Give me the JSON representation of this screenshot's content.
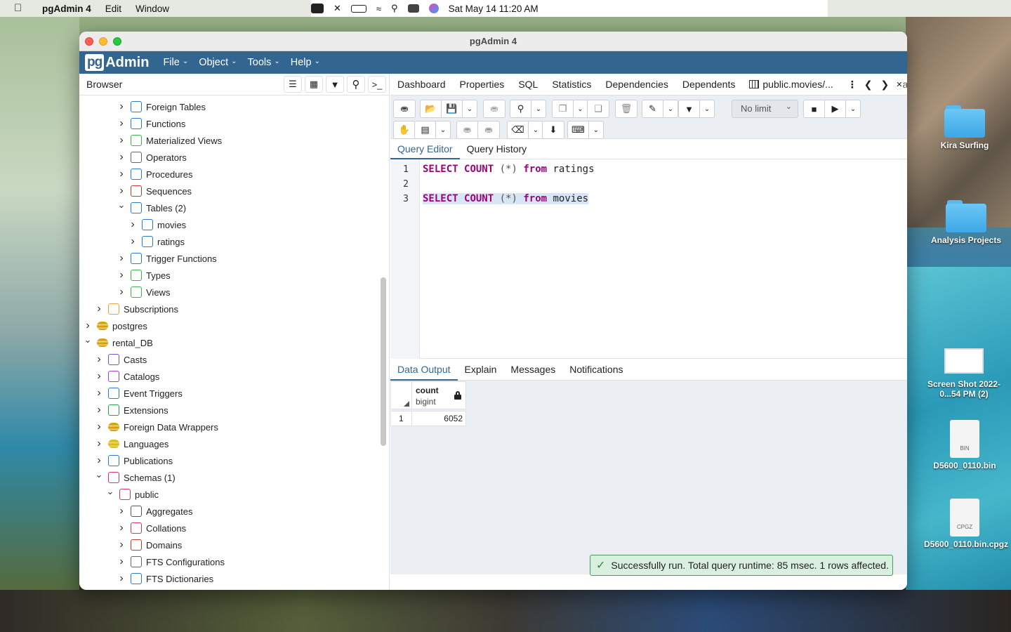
{
  "menubar": {
    "app": "pgAdmin 4",
    "items": [
      "Edit",
      "Window"
    ],
    "clock": "Sat May 14  11:20 AM"
  },
  "window": {
    "title": "pgAdmin 4"
  },
  "appnav": {
    "logo_pg": "pg",
    "logo_admin": "Admin",
    "menus": [
      "File",
      "Object",
      "Tools",
      "Help"
    ]
  },
  "browser": {
    "title": "Browser",
    "tree": [
      {
        "label": "Foreign Tables",
        "icon": "foreign-table-icon",
        "expanded": false
      },
      {
        "label": "Functions",
        "icon": "function-icon",
        "expanded": false
      },
      {
        "label": "Materialized Views",
        "icon": "materialized-view-icon",
        "expanded": false
      },
      {
        "label": "Operators",
        "icon": "operator-icon",
        "expanded": false
      },
      {
        "label": "Procedures",
        "icon": "procedure-icon",
        "expanded": false
      },
      {
        "label": "Sequences",
        "icon": "sequence-icon",
        "expanded": false
      },
      {
        "label": "Tables (2)",
        "icon": "tables-icon",
        "expanded": true
      },
      {
        "label": "movies",
        "icon": "table-icon",
        "expanded": false
      },
      {
        "label": "ratings",
        "icon": "table-icon",
        "expanded": false
      },
      {
        "label": "Trigger Functions",
        "icon": "trigger-function-icon",
        "expanded": false
      },
      {
        "label": "Types",
        "icon": "type-icon",
        "expanded": false
      },
      {
        "label": "Views",
        "icon": "view-icon",
        "expanded": false
      },
      {
        "label": "Subscriptions",
        "icon": "subscription-icon",
        "expanded": false
      },
      {
        "label": "postgres",
        "icon": "database-icon",
        "expanded": false
      },
      {
        "label": "rental_DB",
        "icon": "database-icon",
        "expanded": true
      },
      {
        "label": "Casts",
        "icon": "cast-icon",
        "expanded": false
      },
      {
        "label": "Catalogs",
        "icon": "catalog-icon",
        "expanded": false
      },
      {
        "label": "Event Triggers",
        "icon": "event-trigger-icon",
        "expanded": false
      },
      {
        "label": "Extensions",
        "icon": "extension-icon",
        "expanded": false
      },
      {
        "label": "Foreign Data Wrappers",
        "icon": "fdw-icon",
        "expanded": false
      },
      {
        "label": "Languages",
        "icon": "language-icon",
        "expanded": false
      },
      {
        "label": "Publications",
        "icon": "publication-icon",
        "expanded": false
      },
      {
        "label": "Schemas (1)",
        "icon": "schema-icon",
        "expanded": true
      },
      {
        "label": "public",
        "icon": "schema-public-icon",
        "expanded": true
      },
      {
        "label": "Aggregates",
        "icon": "aggregate-icon",
        "expanded": false
      },
      {
        "label": "Collations",
        "icon": "collation-icon",
        "expanded": false
      },
      {
        "label": "Domains",
        "icon": "domain-icon",
        "expanded": false
      },
      {
        "label": "FTS Configurations",
        "icon": "fts-config-icon",
        "expanded": false
      },
      {
        "label": "FTS Dictionaries",
        "icon": "fts-dictionary-icon",
        "expanded": false
      }
    ]
  },
  "tabs": [
    "Dashboard",
    "Properties",
    "SQL",
    "Statistics",
    "Dependencies",
    "Dependents"
  ],
  "query_tab": {
    "label": "public.movies/...",
    "close": "✕",
    "extra": "at"
  },
  "toolbar": {
    "limit": "No limit"
  },
  "editor": {
    "tabs": [
      "Query Editor",
      "Query History"
    ],
    "lines": [
      {
        "num": "1",
        "tokens": [
          [
            "kw",
            "SELECT"
          ],
          [
            "sp",
            " "
          ],
          [
            "kw",
            "COUNT"
          ],
          [
            "sp",
            " "
          ],
          [
            "op",
            "(*)"
          ],
          [
            "sp",
            " "
          ],
          [
            "kw",
            "from"
          ],
          [
            "sp",
            " "
          ],
          [
            "id",
            "ratings"
          ]
        ]
      },
      {
        "num": "2",
        "tokens": []
      },
      {
        "num": "3",
        "tokens": [
          [
            "kw",
            "SELECT"
          ],
          [
            "sp",
            " "
          ],
          [
            "kw",
            "COUNT"
          ],
          [
            "sp",
            " "
          ],
          [
            "op",
            "(*)"
          ],
          [
            "sp",
            " "
          ],
          [
            "kw",
            "from"
          ],
          [
            "sp",
            " "
          ],
          [
            "id",
            "movies"
          ]
        ]
      }
    ]
  },
  "output": {
    "tabs": [
      "Data Output",
      "Explain",
      "Messages",
      "Notifications"
    ],
    "column": {
      "name": "count",
      "type": "bigint"
    },
    "rows": [
      {
        "num": "1",
        "value": "6052"
      }
    ],
    "message": "Successfully run. Total query runtime: 85 msec. 1 rows affected."
  },
  "desktop": {
    "items": [
      "Kira Surfing",
      "Analysis Projects",
      "Screen Shot 2022-0...54 PM (2)",
      "D5600_0110.bin",
      "D5600_0110.bin.cpgz"
    ],
    "file_types": [
      "BIN",
      "CPGZ"
    ]
  }
}
